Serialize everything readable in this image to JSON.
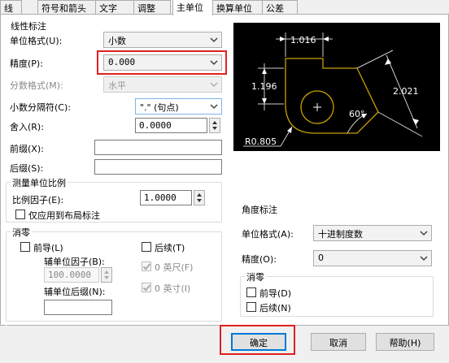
{
  "tabs": [
    {
      "label": "线"
    },
    {
      "label": "符号和箭头"
    },
    {
      "label": "文字"
    },
    {
      "label": "调整"
    },
    {
      "label": "主单位"
    },
    {
      "label": "换算单位"
    },
    {
      "label": "公差"
    }
  ],
  "linear": {
    "group_title": "线性标注",
    "unit_format_label": "单位格式(U):",
    "unit_format_value": "小数",
    "precision_label": "精度(P):",
    "precision_value": "0.000",
    "fraction_label": "分数格式(M):",
    "fraction_value": "水平",
    "decimal_sep_label": "小数分隔符(C):",
    "decimal_sep_value": "\".\" (句点)",
    "round_label": "舍入(R):",
    "round_value": "0.0000",
    "prefix_label": "前缀(X):",
    "prefix_value": "",
    "suffix_label": "后缀(S):",
    "suffix_value": ""
  },
  "scale": {
    "group_title": "测量单位比例",
    "factor_label": "比例因子(E):",
    "factor_value": "1.0000",
    "layout_only_label": "仅应用到布局标注"
  },
  "zero_linear": {
    "group_title": "消零",
    "leading_label": "前导(L)",
    "trailing_label": "后续(T)",
    "subunit_factor_label": "辅单位因子(B):",
    "subunit_factor_value": "100.0000",
    "zero_feet_label": "0 英尺(F)",
    "subunit_suffix_label": "辅单位后缀(N):",
    "subunit_suffix_value": "",
    "zero_inches_label": "0 英寸(I)"
  },
  "angular": {
    "group_title": "角度标注",
    "unit_format_label": "单位格式(A):",
    "unit_format_value": "十进制度数",
    "precision_label": "精度(O):",
    "precision_value": "0",
    "zero_title": "消零",
    "leading_label": "前导(D)",
    "trailing_label": "后续(N)"
  },
  "preview": {
    "dim_top": "1.016",
    "dim_left": "1.196",
    "dim_right": "2.021",
    "dim_angle": "60°",
    "dim_radius": "R0.805"
  },
  "buttons": {
    "ok": "确定",
    "cancel": "取消",
    "help": "帮助(H)"
  },
  "colors": {
    "highlight": "#e02020",
    "preview_bg": "#000000",
    "preview_shape": "#c8a000"
  }
}
